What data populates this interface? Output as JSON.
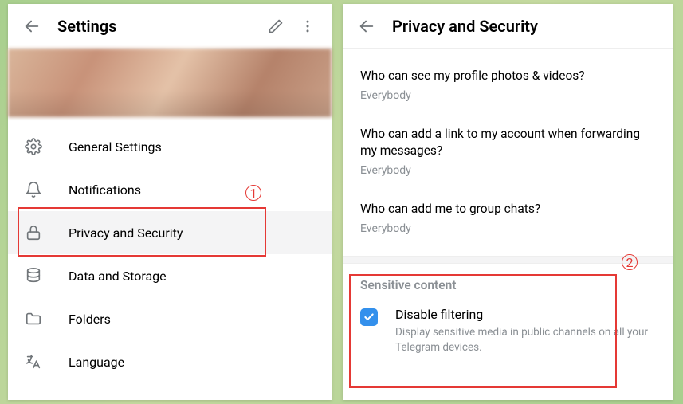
{
  "leftPanel": {
    "title": "Settings",
    "menu": [
      {
        "icon": "gear",
        "label": "General Settings"
      },
      {
        "icon": "bell",
        "label": "Notifications"
      },
      {
        "icon": "lock",
        "label": "Privacy and Security"
      },
      {
        "icon": "database",
        "label": "Data and Storage"
      },
      {
        "icon": "folder",
        "label": "Folders"
      },
      {
        "icon": "language",
        "label": "Language"
      }
    ]
  },
  "rightPanel": {
    "title": "Privacy and Security",
    "privacyItems": [
      {
        "question": "Who can see my profile photos & videos?",
        "value": "Everybody"
      },
      {
        "question": "Who can add a link to my account when forwarding my messages?",
        "value": "Everybody"
      },
      {
        "question": "Who can add me to group chats?",
        "value": "Everybody"
      }
    ],
    "sensitive": {
      "header": "Sensitive content",
      "optionTitle": "Disable filtering",
      "optionDesc": "Display sensitive media in public channels on all your Telegram devices.",
      "checked": true
    }
  },
  "annotations": {
    "one": "1",
    "two": "2"
  }
}
